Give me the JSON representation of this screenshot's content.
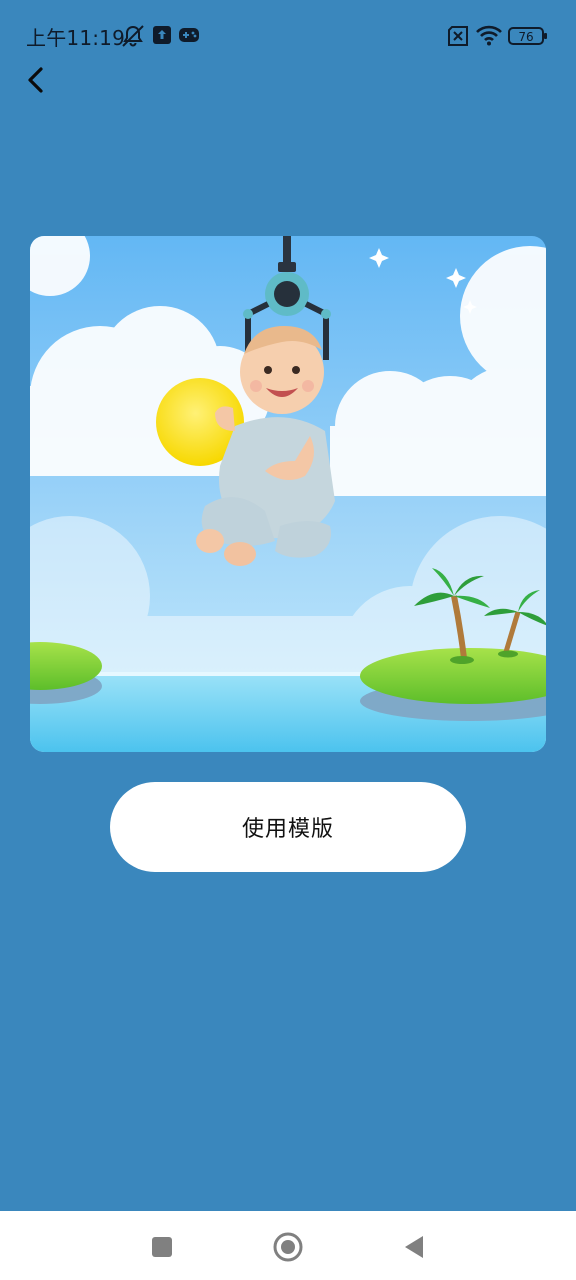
{
  "colors": {
    "background": "#3A87BD",
    "button_bg": "#FFFFFF",
    "nav_bg": "#FFFFFF"
  },
  "status_bar": {
    "time": "上午11:19",
    "battery": "76",
    "icons": [
      "bell-off-icon",
      "upload-icon",
      "gamepad-icon",
      "sim-off-icon",
      "wifi-icon",
      "battery-icon"
    ]
  },
  "toolbar": {
    "back_icon": "chevron-left-icon"
  },
  "template": {
    "image_description_icon": "template-preview-image"
  },
  "actions": {
    "use_template_label": "使用模版"
  },
  "nav": {
    "icons": [
      "recents-square-icon",
      "home-circle-icon",
      "back-triangle-icon"
    ]
  }
}
